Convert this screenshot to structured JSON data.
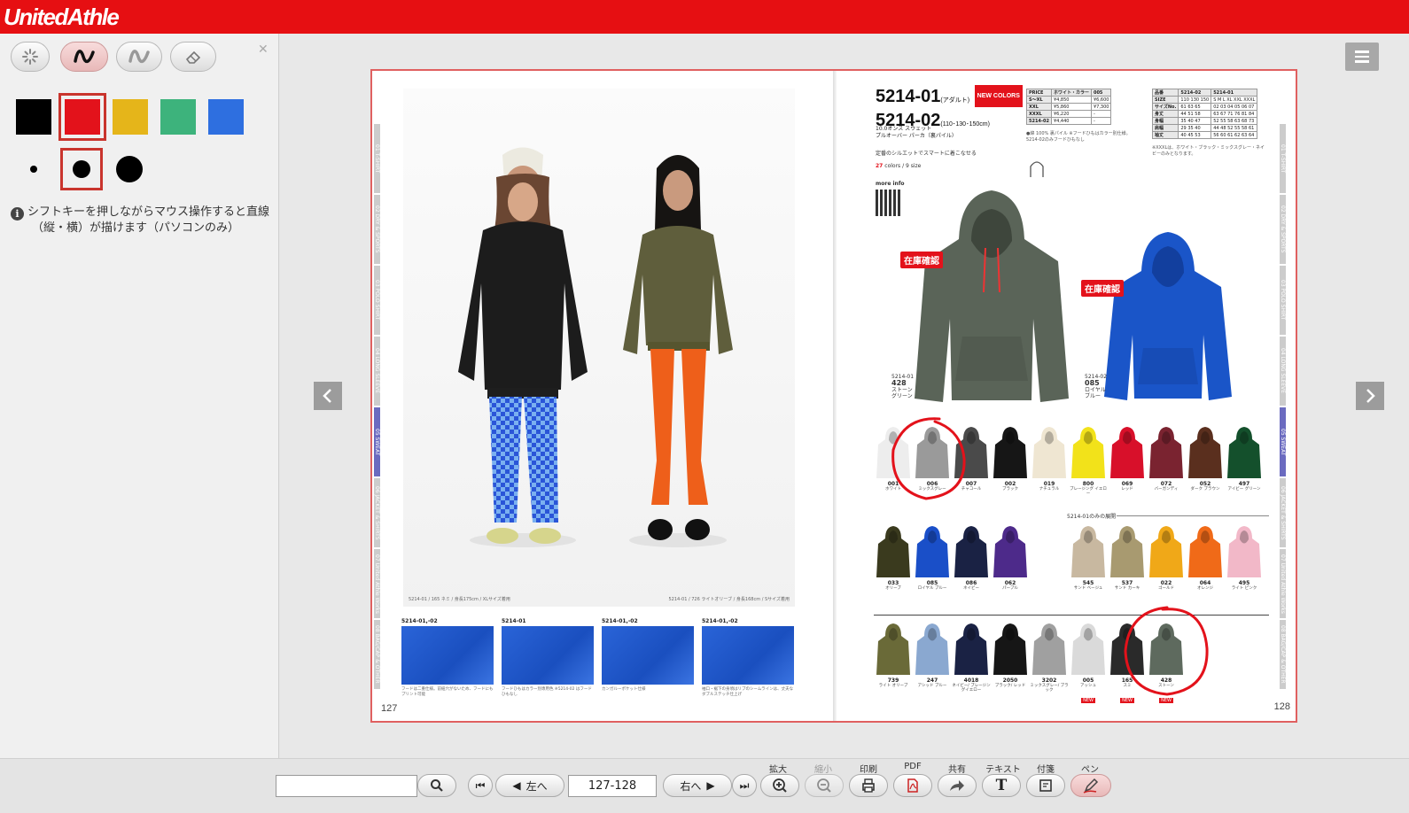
{
  "app": {
    "logo": "UnitedAthle"
  },
  "pen_panel": {
    "tools": [
      "pointer-tool",
      "pen-tool",
      "highlighter-tool",
      "eraser-tool"
    ],
    "colors": [
      "#000000",
      "#e3121b",
      "#e5b51a",
      "#3db37c",
      "#2e6fe0"
    ],
    "selected_color": "#e3121b",
    "sizes": [
      "small",
      "medium",
      "large"
    ],
    "selected_size": "medium",
    "hint_line1": "シフトキーを押しながらマウス操作すると直線",
    "hint_line2": "（縦・横）が描けます（パソコンのみ）"
  },
  "left_page": {
    "caption_left": "5214-01 / 165 ネミ / 身長175cm / XLサイズ着用",
    "caption_right": "5214-01 / 726 ライトオリーブ / 身長168cm / Sサイズ着用",
    "tabs": [
      "01 T-SHIRT",
      "02 DRY & SPORTS",
      "03 POLO SHIRT",
      "04 LONG SLEEVE",
      "05 SWEAT",
      "06 JACKET & SHIRTS",
      "07 United Athle Works",
      "08 BAG/CAP & OTHER"
    ],
    "active_tab": 4,
    "thumbs": [
      {
        "title": "5214-01,-02",
        "caption": "フードは二重仕様。前紐穴がないため、フードにもプリント可能"
      },
      {
        "title": "5214-01",
        "caption": "フードひもはカラー別専用色 ※5214-02 はフードひもなし"
      },
      {
        "title": "5214-01,-02",
        "caption": "カンガルーポケット仕様"
      },
      {
        "title": "5214-01,-02",
        "caption": "袖口・裾下の身頃はリブのシームラインは、丈夫なダブルステッチ仕上げ"
      }
    ],
    "page_number": "127"
  },
  "right_page": {
    "product_num_1": "5214-01",
    "product_tag_1": "(アダルト)",
    "new_colors": "NEW COLORS",
    "product_num_2": "5214-02",
    "product_tag_2": "(110･130･150cm)",
    "desc_line1": "10.0オンス スウェット",
    "desc_line2": "プルオーバー パーカ（裏パイル）",
    "desc_line3": "定番のシルエットでスマートに着こなせる",
    "colors_sizes_num": "27",
    "colors_sizes_text": " colors / 9 size",
    "more_info": "more info",
    "price_table": [
      [
        "PRICE",
        "ホワイト・カラー",
        "005"
      ],
      [
        "S～XL",
        "¥4,850",
        "¥6,600"
      ],
      [
        "XXL",
        "¥5,860",
        "¥7,300"
      ],
      [
        "XXXL",
        "¥6,220",
        "-"
      ],
      [
        "5214-02",
        "¥4,440",
        "-"
      ]
    ],
    "size_table": [
      [
        "品番",
        "5214-02",
        "5214-01"
      ],
      [
        "SIZE",
        "110 130 150",
        "S M L XL XXL XXXL"
      ],
      [
        "サイズNo.",
        "61 63 65",
        "02 03 04 05 06 07"
      ],
      [
        "身丈",
        "44 51 58",
        "63 67 71 76 81 84"
      ],
      [
        "身幅",
        "35 40 47",
        "52 55 58 63 68 73"
      ],
      [
        "肩幅",
        "29 35 40",
        "44 48 52 55 58 61"
      ],
      [
        "袖丈",
        "40 45 53",
        "56 60 61 62 63 64"
      ]
    ],
    "price_note": "●綿 100% 裏パイル ※フードひもはカラー別仕様。 5214-02のみフードひもなし",
    "size_note": "※XXXLは、ホワイト・ブラック・ミックスグレー・ネイビーのみとなります。",
    "stock_label": "在庫確認",
    "main_product_1": {
      "num": "5214-01",
      "code": "428",
      "name": "ストーン グリーン"
    },
    "main_product_2": {
      "num": "5214-02",
      "code": "085",
      "name": "ロイヤル ブルー"
    },
    "swatches_row1": [
      {
        "code": "001",
        "name": "ホワイト",
        "color": "#ededed"
      },
      {
        "code": "006",
        "name": "ミックスグレー",
        "color": "#9a9a9a"
      },
      {
        "code": "007",
        "name": "チャコール",
        "color": "#4a4a4a"
      },
      {
        "code": "002",
        "name": "ブラック",
        "color": "#161616"
      },
      {
        "code": "019",
        "name": "ナチュラル",
        "color": "#efe6d2"
      },
      {
        "code": "800",
        "name": "ブレージング イエロー",
        "color": "#f2e21a"
      },
      {
        "code": "069",
        "name": "レッド",
        "color": "#d8102a"
      },
      {
        "code": "072",
        "name": "バーガンディ",
        "color": "#7a2330"
      },
      {
        "code": "052",
        "name": "ダーク ブラウン",
        "color": "#5a2f1e"
      },
      {
        "code": "497",
        "name": "アイビー グリーン",
        "color": "#14502c"
      }
    ],
    "sublabel": "5214-01のみの展開",
    "swatches_row2": [
      {
        "code": "033",
        "name": "オリーブ",
        "color": "#3a3a1e"
      },
      {
        "code": "085",
        "name": "ロイヤル ブルー",
        "color": "#1a4fc8"
      },
      {
        "code": "086",
        "name": "ネイビー",
        "color": "#1a2244"
      },
      {
        "code": "062",
        "name": "パープル",
        "color": "#4d2a8a"
      },
      {
        "code": "545",
        "name": "サンド ベージュ",
        "color": "#c8b8a0"
      },
      {
        "code": "537",
        "name": "サンド カーキ",
        "color": "#a89a70"
      },
      {
        "code": "022",
        "name": "ゴールド",
        "color": "#f0a818"
      },
      {
        "code": "064",
        "name": "オレンジ",
        "color": "#f06a18"
      },
      {
        "code": "495",
        "name": "ライト ピンク",
        "color": "#f2b8c8"
      }
    ],
    "swatches_row3": [
      {
        "code": "739",
        "name": "ライト オリーブ",
        "color": "#6a6a38",
        "new": false
      },
      {
        "code": "247",
        "name": "アシッド ブルー",
        "color": "#8aa8d0",
        "new": false
      },
      {
        "code": "4018",
        "name": "ネイビー/ ブレージングイエロー",
        "color": "#1a2244",
        "new": false
      },
      {
        "code": "2050",
        "name": "ブラック/ レッド",
        "color": "#161616",
        "new": false
      },
      {
        "code": "3202",
        "name": "ミックスグレー/ ブラック",
        "color": "#a0a0a0",
        "new": false
      },
      {
        "code": "005",
        "name": "アッシュ",
        "color": "#dadada",
        "new": true
      },
      {
        "code": "165",
        "name": "スミ",
        "color": "#2a2a2a",
        "new": true
      },
      {
        "code": "428",
        "name": "ストーン",
        "color": "#5e6a5e",
        "new": true
      }
    ],
    "new_label": "NEW",
    "page_number": "128"
  },
  "bottom": {
    "search_value": "",
    "prev_label": "左へ",
    "next_label": "右へ",
    "page_value": "127-128",
    "labels": {
      "zoom_in": "拡大",
      "zoom_out": "縮小",
      "print": "印刷",
      "pdf": "PDF",
      "share": "共有",
      "text": "テキスト",
      "sticky": "付箋",
      "pen": "ペン"
    }
  }
}
